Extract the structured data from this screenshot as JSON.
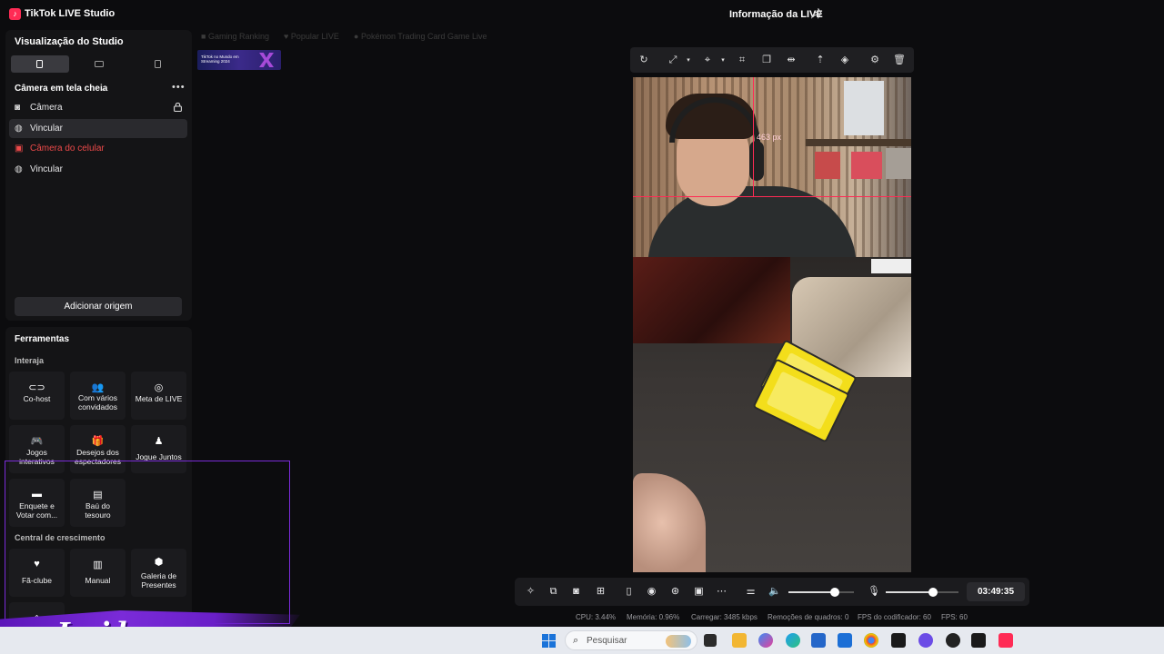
{
  "titlebar": {
    "app_title": "TikTok LIVE Studio",
    "live_info": "Informação da LIVE"
  },
  "studio": {
    "title": "Visualização do Studio",
    "scene_name": "Câmera em tela cheia",
    "sources": [
      {
        "label": "Câmera",
        "icon": "camera-icon",
        "state": "normal",
        "locked": true
      },
      {
        "label": "Vincular",
        "icon": "globe-icon",
        "state": "selected",
        "locked": false
      },
      {
        "label": "Câmera do celular",
        "icon": "phone-camera-icon",
        "state": "error",
        "locked": false
      },
      {
        "label": "Vincular",
        "icon": "globe-icon",
        "state": "normal",
        "locked": false
      }
    ],
    "add_source": "Adicionar origem"
  },
  "tools": {
    "title": "Ferramentas",
    "section_interact": "Interaja",
    "section_growth": "Central de crescimento",
    "interact_items": [
      {
        "label": "Co-host",
        "icon": "link-icon"
      },
      {
        "label": "Com vários convidados",
        "icon": "guests-icon"
      },
      {
        "label": "Meta de LIVE",
        "icon": "target-icon"
      },
      {
        "label": "Jogos interativos",
        "icon": "gamepad-icon"
      },
      {
        "label": "Desejos dos espectadores",
        "icon": "gift-icon"
      },
      {
        "label": "Jogue Juntos",
        "icon": "joystick-icon"
      },
      {
        "label": "Enquete e Votar com...",
        "icon": "poll-icon"
      },
      {
        "label": "Baú do tesouro",
        "icon": "chest-icon"
      }
    ],
    "growth_items": [
      {
        "label": "Fã-clube",
        "icon": "heart-icon"
      },
      {
        "label": "Manual",
        "icon": "book-icon"
      },
      {
        "label": "Galeria de Presentes",
        "icon": "badge-icon"
      }
    ]
  },
  "scene_tabs": [
    "Gaming Ranking",
    "Popular LIVE",
    "Pokémon Trading Card Game Live"
  ],
  "thumbnail": {
    "caption": "TikTok no Mundo em Streaming 2024"
  },
  "preview": {
    "guide_label": "463 px"
  },
  "controls": {
    "timer": "03:49:35",
    "volume": 0.71,
    "mic": 0.65
  },
  "stats": {
    "cpu": "CPU: 3.44%",
    "memory": "Memória: 0.96%",
    "upload": "Carregar: 3485 kbps",
    "dropped": "Remoções de quadros: 0",
    "encoder_fps": "FPS do codificador: 60",
    "fps": "FPS: 60"
  },
  "overlay": {
    "brand": "Insider"
  },
  "taskbar": {
    "search_placeholder": "Pesquisar"
  },
  "colors": {
    "accent": "#ff2b55",
    "error": "#ee4a4a",
    "overlay_purple": "#7a2bd8"
  }
}
